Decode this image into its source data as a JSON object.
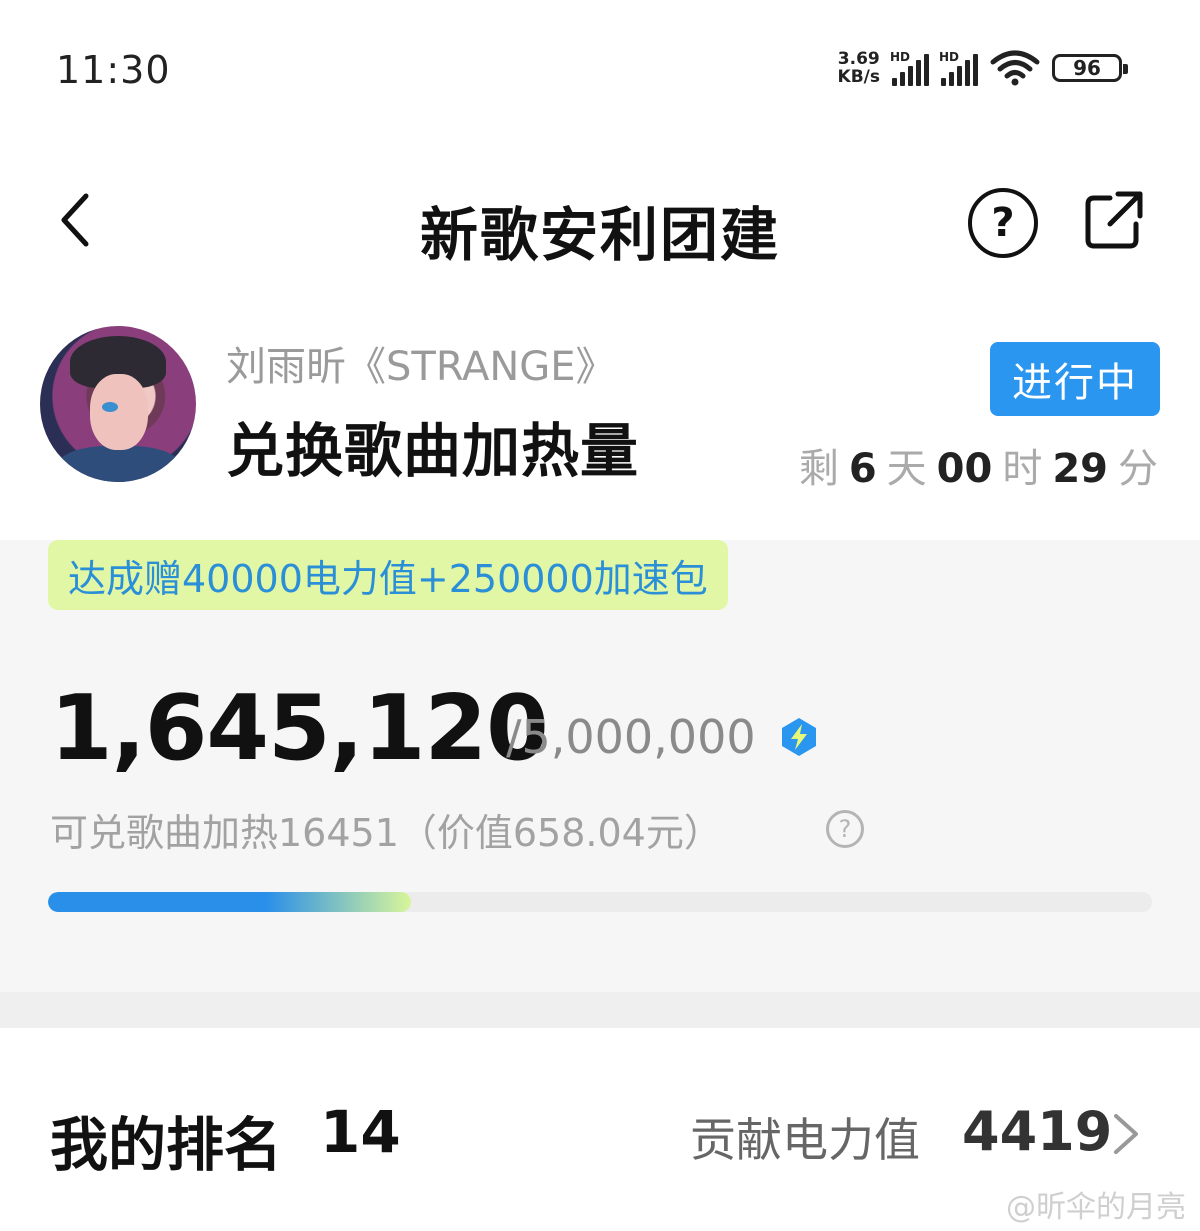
{
  "status_bar": {
    "time": "11:30",
    "net_speed_value": "3.69",
    "net_speed_unit": "KB/s",
    "sim1_label": "HD",
    "sim2_label": "HD",
    "battery": "96",
    "icons": [
      "signal-icon",
      "signal-icon",
      "wifi-icon",
      "battery-icon"
    ]
  },
  "nav": {
    "title": "新歌安利团建",
    "back_icon": "chevron-left-icon",
    "help_label": "?",
    "share_icon": "share-icon"
  },
  "header": {
    "song_subtitle": "刘雨昕《STRANGE》",
    "task_title": "兑换歌曲加热量",
    "status_badge": "进行中",
    "countdown": {
      "prefix": "剩",
      "days": "6",
      "days_unit": "天",
      "hours": "00",
      "hours_unit": "时",
      "minutes": "29",
      "minutes_unit": "分"
    }
  },
  "progress": {
    "reward_tag": "达成赠40000电力值+250000加速包",
    "current": "1,645,120",
    "target": "/5,000,000",
    "exchange_info": "可兑歌曲加热16451（价值658.04元）",
    "info_label": "?",
    "fraction": 0.329,
    "colors": {
      "fill_start": "#2a8fe8",
      "fill_end": "#d8f59a",
      "badge": "#2b96f0",
      "reward_bg": "#e2f7a5",
      "reward_text": "#2b8fd8"
    }
  },
  "ranking": {
    "label": "我的排名",
    "rank": "14",
    "contribution_label": "贡献电力值",
    "contribution_value": "4419"
  },
  "watermark": "@昕伞的月亮"
}
